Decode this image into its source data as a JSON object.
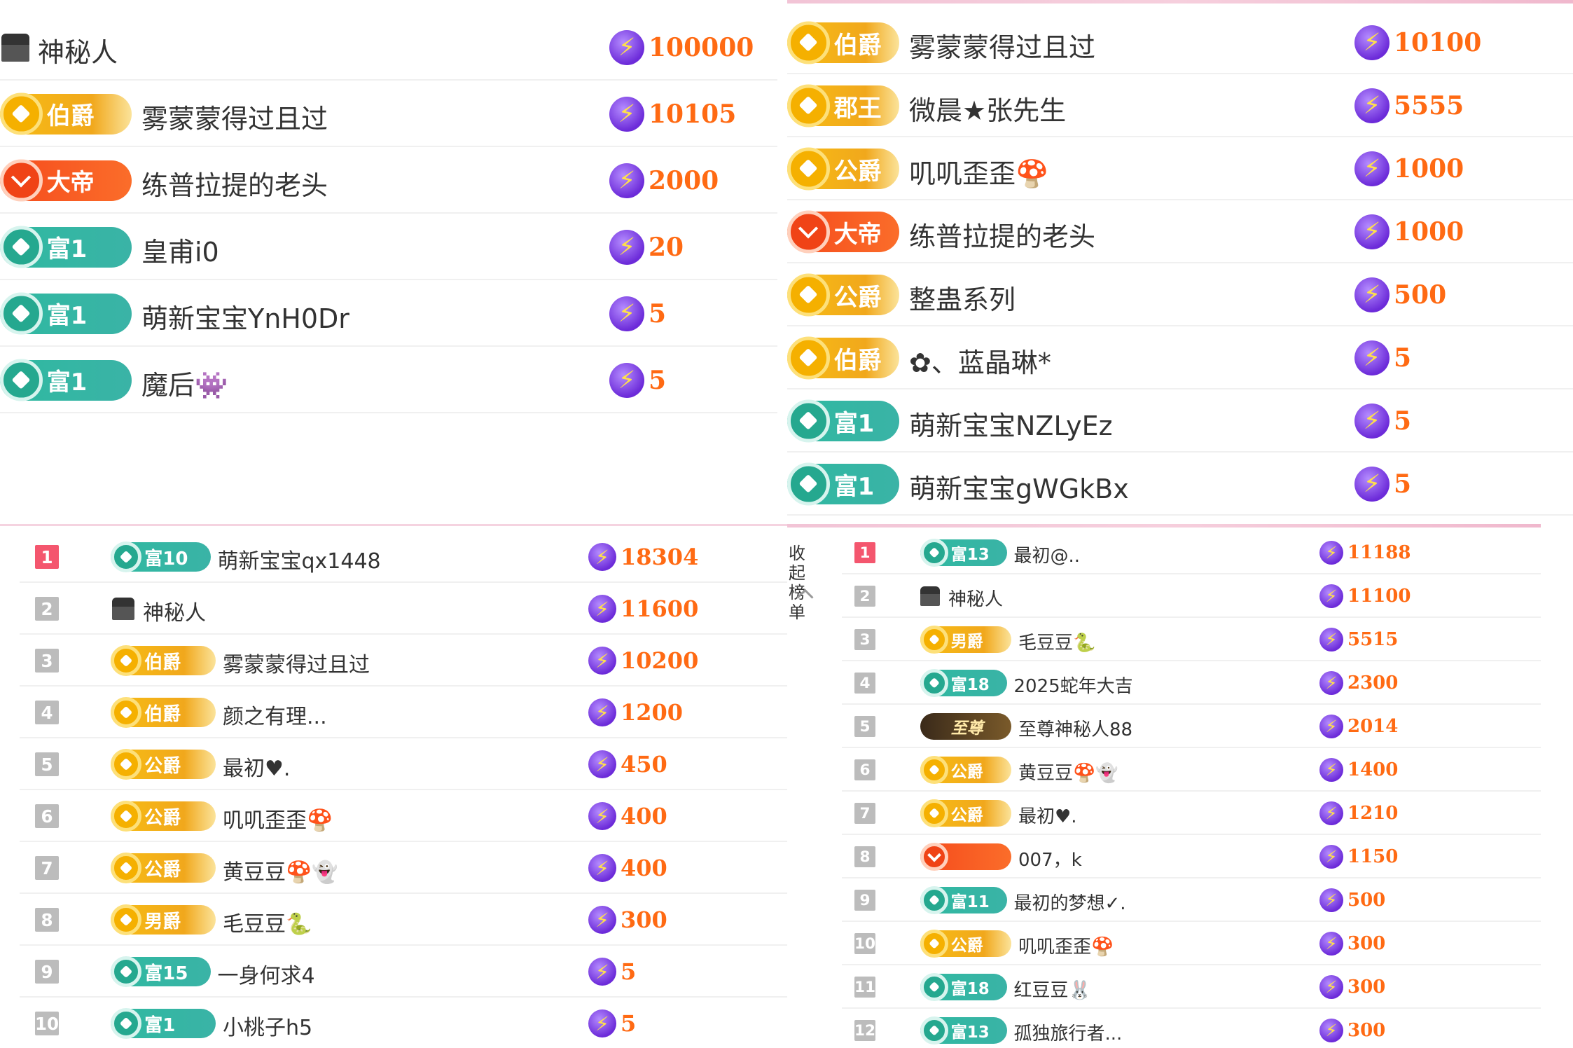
{
  "top_left": {
    "rows": [
      {
        "mystery": true,
        "name": "神秘人",
        "gift": "100000"
      },
      {
        "badge": "伯爵",
        "style": "gold",
        "name": "雾蒙蒙得过且过",
        "gift": "10105"
      },
      {
        "badge": "大帝",
        "style": "red",
        "name": "练普拉提的老头",
        "gift": "2000"
      },
      {
        "badge": "富1",
        "style": "teal",
        "name": "皇甫i0",
        "gift": "20"
      },
      {
        "badge": "富1",
        "style": "teal",
        "name": "萌新宝宝YnH0Dr",
        "gift": "5"
      },
      {
        "badge": "富1",
        "style": "teal",
        "name": "魔后👾",
        "gift": "5"
      }
    ]
  },
  "top_right": {
    "rows": [
      {
        "badge": "伯爵",
        "style": "gold",
        "name": "雾蒙蒙得过且过",
        "gift": "10100"
      },
      {
        "badge": "郡王",
        "style": "gold",
        "name": "微晨★张先生",
        "gift": "5555"
      },
      {
        "badge": "公爵",
        "style": "gold",
        "name": "叽叽歪歪🍄",
        "gift": "1000"
      },
      {
        "badge": "大帝",
        "style": "red",
        "name": "练普拉提的老头",
        "gift": "1000"
      },
      {
        "badge": "公爵",
        "style": "gold",
        "name": "整蛊系列",
        "gift": "500"
      },
      {
        "badge": "伯爵",
        "style": "gold",
        "name": "✿、蓝晶琳*",
        "gift": "5"
      },
      {
        "badge": "富1",
        "style": "teal",
        "name": "萌新宝宝NZLyEz",
        "gift": "5"
      },
      {
        "badge": "富1",
        "style": "teal",
        "name": "萌新宝宝gWGkBx",
        "gift": "5"
      }
    ]
  },
  "bottom_left": {
    "rows": [
      {
        "rank": "1",
        "badge": "富10",
        "style": "teal",
        "name": "萌新宝宝qx1448",
        "gift": "18304"
      },
      {
        "rank": "2",
        "mystery": true,
        "name": "神秘人",
        "gift": "11600"
      },
      {
        "rank": "3",
        "badge": "伯爵",
        "style": "gold",
        "name": "雾蒙蒙得过且过",
        "gift": "10200"
      },
      {
        "rank": "4",
        "badge": "伯爵",
        "style": "gold",
        "name": "颜之有理...",
        "gift": "1200"
      },
      {
        "rank": "5",
        "badge": "公爵",
        "style": "gold",
        "name": "最初♥.",
        "gift": "450"
      },
      {
        "rank": "6",
        "badge": "公爵",
        "style": "gold",
        "name": "叽叽歪歪🍄",
        "gift": "400"
      },
      {
        "rank": "7",
        "badge": "公爵",
        "style": "gold",
        "name": "黄豆豆🍄👻",
        "gift": "400"
      },
      {
        "rank": "8",
        "badge": "男爵",
        "style": "gold",
        "name": "毛豆豆🐍",
        "gift": "300"
      },
      {
        "rank": "9",
        "badge": "富15",
        "style": "teal",
        "name": "一身何求4",
        "gift": "5"
      },
      {
        "rank": "10",
        "badge": "富1",
        "style": "teal",
        "name": "小桃子h5",
        "gift": "5"
      }
    ]
  },
  "bottom_right": {
    "collapse_label": "收起榜单",
    "rows": [
      {
        "rank": "1",
        "badge": "富13",
        "style": "teal",
        "name": "最初@..",
        "gift": "11188"
      },
      {
        "rank": "2",
        "mystery": true,
        "name": "神秘人",
        "gift": "11100"
      },
      {
        "rank": "3",
        "badge": "男爵",
        "style": "gold",
        "name": "毛豆豆🐍",
        "gift": "5515"
      },
      {
        "rank": "4",
        "badge": "富18",
        "style": "teal",
        "name": "2025蛇年大吉",
        "gift": "2300"
      },
      {
        "rank": "5",
        "badge": "至尊",
        "style": "dark",
        "name": "至尊神秘人88",
        "gift": "2014"
      },
      {
        "rank": "6",
        "badge": "公爵",
        "style": "gold",
        "name": "黄豆豆🍄👻",
        "gift": "1400"
      },
      {
        "rank": "7",
        "badge": "公爵",
        "style": "gold",
        "name": "最初♥.",
        "gift": "1210"
      },
      {
        "rank": "8",
        "badge": "",
        "style": "red",
        "name": "007，k",
        "gift": "1150"
      },
      {
        "rank": "9",
        "badge": "富11",
        "style": "teal",
        "name": "最初的梦想✓.",
        "gift": "500"
      },
      {
        "rank": "10",
        "badge": "公爵",
        "style": "gold",
        "name": "叽叽歪歪🍄",
        "gift": "300"
      },
      {
        "rank": "11",
        "badge": "富18",
        "style": "teal",
        "name": "红豆豆🐰",
        "gift": "300"
      },
      {
        "rank": "12",
        "badge": "富13",
        "style": "teal",
        "name": "孤独旅行者...",
        "gift": "300"
      }
    ]
  }
}
